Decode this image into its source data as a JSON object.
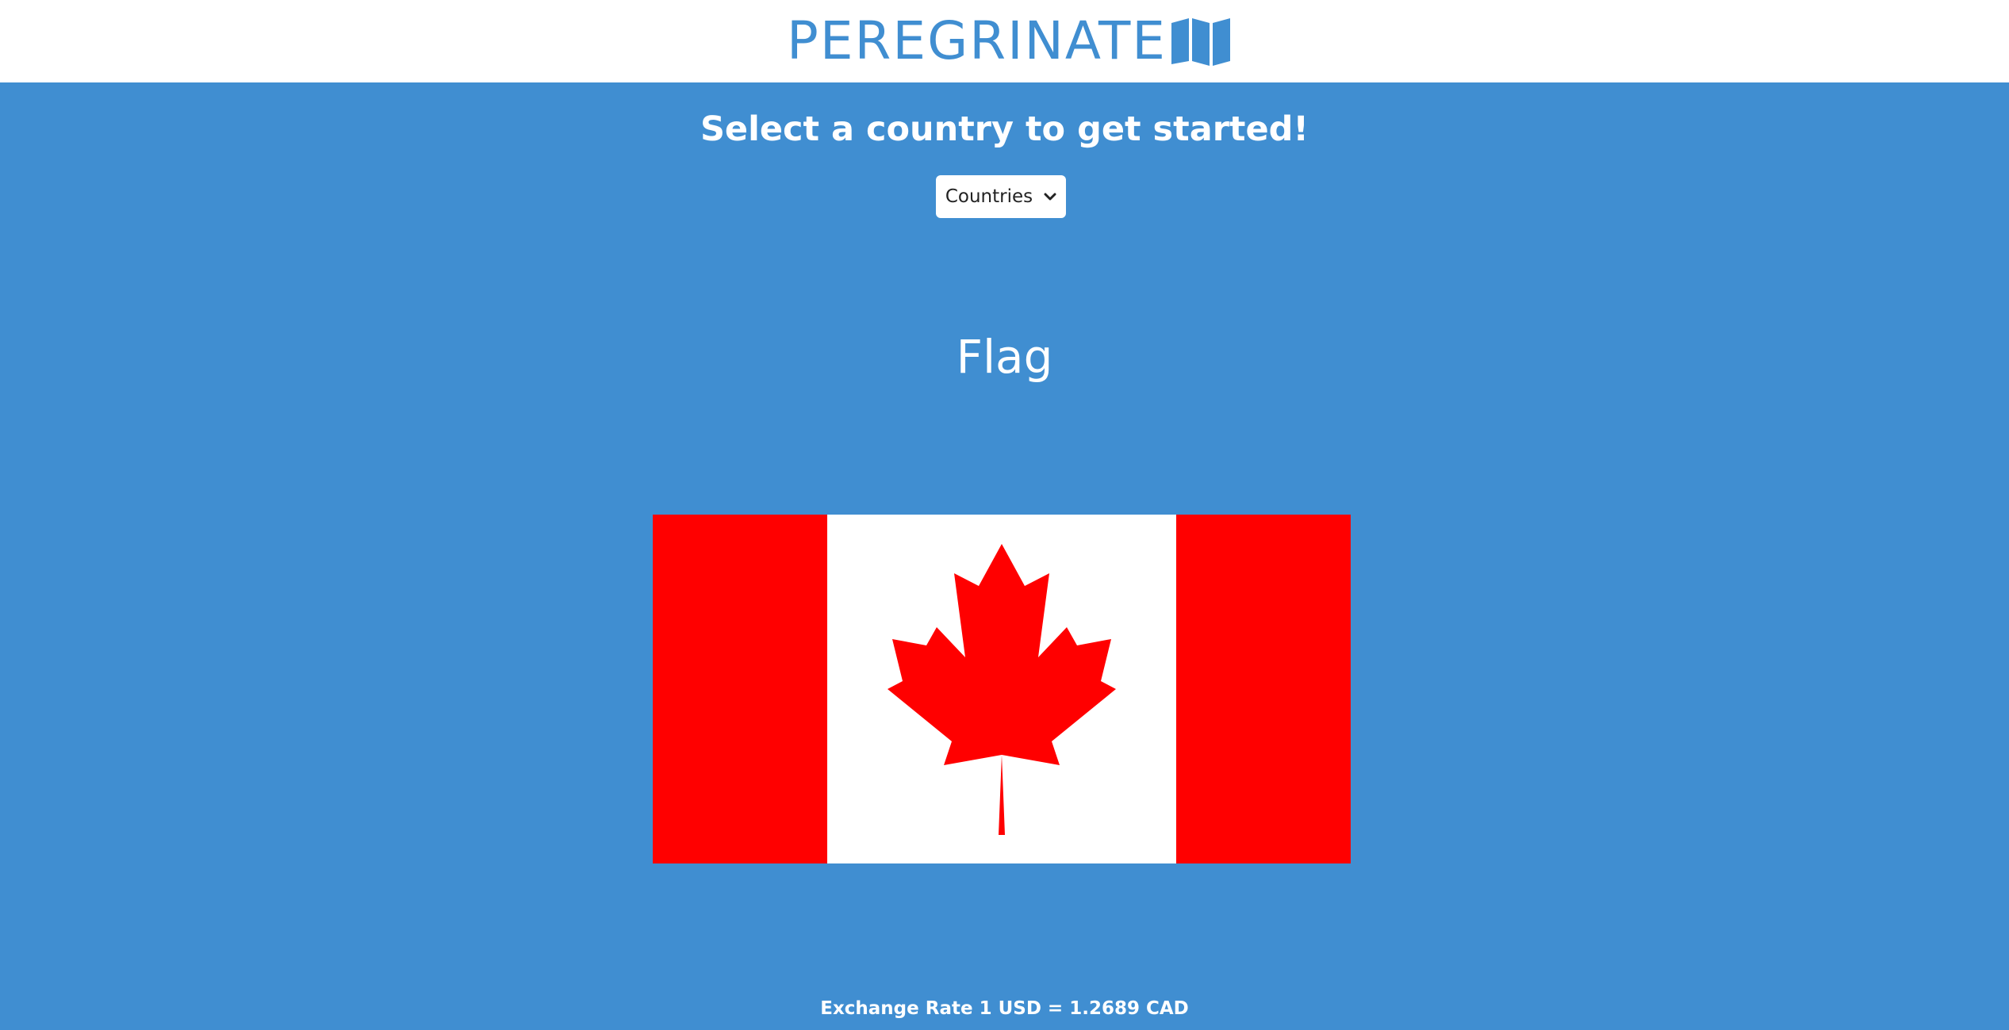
{
  "header": {
    "brand": "PEREGRINATE",
    "brand_icon": "folded-map-icon",
    "brand_color": "#408ed1"
  },
  "main": {
    "prompt": "Select a country to get started!",
    "country_select": {
      "selected_label": "Countries",
      "icon": "chevron-down-icon"
    },
    "flag_section_title": "Flag",
    "flag_country": "Canada",
    "exchange_rate": "Exchange Rate 1 USD = 1.2689 CAD"
  },
  "colors": {
    "background": "#408ed1",
    "header_background": "#ffffff",
    "flag_red": "#ff0000",
    "flag_white": "#ffffff"
  }
}
